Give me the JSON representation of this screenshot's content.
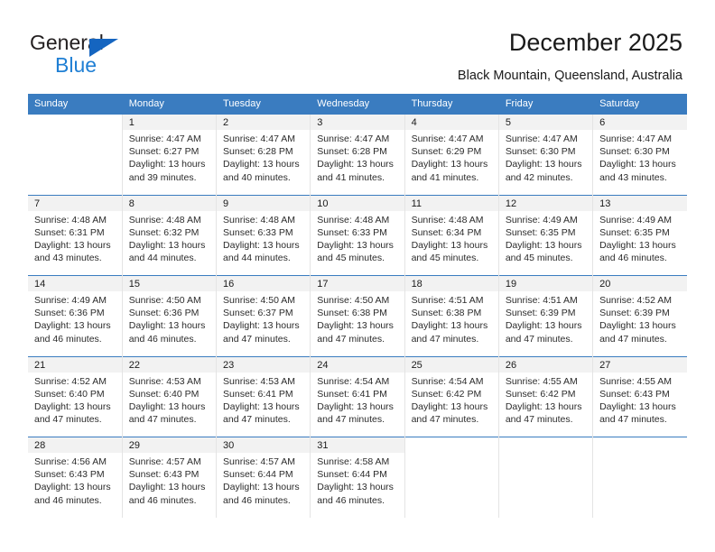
{
  "branding": {
    "name_top": "General",
    "name_bottom": "Blue",
    "triangle_icon": "blue-triangle-icon",
    "accent_color": "#1f7fd4"
  },
  "header": {
    "title": "December 2025",
    "subtitle": "Black Mountain, Queensland, Australia"
  },
  "calendar": {
    "header_bg": "#3a7cc0",
    "header_text_color": "#ffffff",
    "weekday_headers": [
      "Sunday",
      "Monday",
      "Tuesday",
      "Wednesday",
      "Thursday",
      "Friday",
      "Saturday"
    ],
    "weeks": [
      [
        {
          "day": "",
          "lines": []
        },
        {
          "day": "1",
          "lines": [
            "Sunrise: 4:47 AM",
            "Sunset: 6:27 PM",
            "Daylight: 13 hours",
            "and 39 minutes."
          ]
        },
        {
          "day": "2",
          "lines": [
            "Sunrise: 4:47 AM",
            "Sunset: 6:28 PM",
            "Daylight: 13 hours",
            "and 40 minutes."
          ]
        },
        {
          "day": "3",
          "lines": [
            "Sunrise: 4:47 AM",
            "Sunset: 6:28 PM",
            "Daylight: 13 hours",
            "and 41 minutes."
          ]
        },
        {
          "day": "4",
          "lines": [
            "Sunrise: 4:47 AM",
            "Sunset: 6:29 PM",
            "Daylight: 13 hours",
            "and 41 minutes."
          ]
        },
        {
          "day": "5",
          "lines": [
            "Sunrise: 4:47 AM",
            "Sunset: 6:30 PM",
            "Daylight: 13 hours",
            "and 42 minutes."
          ]
        },
        {
          "day": "6",
          "lines": [
            "Sunrise: 4:47 AM",
            "Sunset: 6:30 PM",
            "Daylight: 13 hours",
            "and 43 minutes."
          ]
        }
      ],
      [
        {
          "day": "7",
          "lines": [
            "Sunrise: 4:48 AM",
            "Sunset: 6:31 PM",
            "Daylight: 13 hours",
            "and 43 minutes."
          ]
        },
        {
          "day": "8",
          "lines": [
            "Sunrise: 4:48 AM",
            "Sunset: 6:32 PM",
            "Daylight: 13 hours",
            "and 44 minutes."
          ]
        },
        {
          "day": "9",
          "lines": [
            "Sunrise: 4:48 AM",
            "Sunset: 6:33 PM",
            "Daylight: 13 hours",
            "and 44 minutes."
          ]
        },
        {
          "day": "10",
          "lines": [
            "Sunrise: 4:48 AM",
            "Sunset: 6:33 PM",
            "Daylight: 13 hours",
            "and 45 minutes."
          ]
        },
        {
          "day": "11",
          "lines": [
            "Sunrise: 4:48 AM",
            "Sunset: 6:34 PM",
            "Daylight: 13 hours",
            "and 45 minutes."
          ]
        },
        {
          "day": "12",
          "lines": [
            "Sunrise: 4:49 AM",
            "Sunset: 6:35 PM",
            "Daylight: 13 hours",
            "and 45 minutes."
          ]
        },
        {
          "day": "13",
          "lines": [
            "Sunrise: 4:49 AM",
            "Sunset: 6:35 PM",
            "Daylight: 13 hours",
            "and 46 minutes."
          ]
        }
      ],
      [
        {
          "day": "14",
          "lines": [
            "Sunrise: 4:49 AM",
            "Sunset: 6:36 PM",
            "Daylight: 13 hours",
            "and 46 minutes."
          ]
        },
        {
          "day": "15",
          "lines": [
            "Sunrise: 4:50 AM",
            "Sunset: 6:36 PM",
            "Daylight: 13 hours",
            "and 46 minutes."
          ]
        },
        {
          "day": "16",
          "lines": [
            "Sunrise: 4:50 AM",
            "Sunset: 6:37 PM",
            "Daylight: 13 hours",
            "and 47 minutes."
          ]
        },
        {
          "day": "17",
          "lines": [
            "Sunrise: 4:50 AM",
            "Sunset: 6:38 PM",
            "Daylight: 13 hours",
            "and 47 minutes."
          ]
        },
        {
          "day": "18",
          "lines": [
            "Sunrise: 4:51 AM",
            "Sunset: 6:38 PM",
            "Daylight: 13 hours",
            "and 47 minutes."
          ]
        },
        {
          "day": "19",
          "lines": [
            "Sunrise: 4:51 AM",
            "Sunset: 6:39 PM",
            "Daylight: 13 hours",
            "and 47 minutes."
          ]
        },
        {
          "day": "20",
          "lines": [
            "Sunrise: 4:52 AM",
            "Sunset: 6:39 PM",
            "Daylight: 13 hours",
            "and 47 minutes."
          ]
        }
      ],
      [
        {
          "day": "21",
          "lines": [
            "Sunrise: 4:52 AM",
            "Sunset: 6:40 PM",
            "Daylight: 13 hours",
            "and 47 minutes."
          ]
        },
        {
          "day": "22",
          "lines": [
            "Sunrise: 4:53 AM",
            "Sunset: 6:40 PM",
            "Daylight: 13 hours",
            "and 47 minutes."
          ]
        },
        {
          "day": "23",
          "lines": [
            "Sunrise: 4:53 AM",
            "Sunset: 6:41 PM",
            "Daylight: 13 hours",
            "and 47 minutes."
          ]
        },
        {
          "day": "24",
          "lines": [
            "Sunrise: 4:54 AM",
            "Sunset: 6:41 PM",
            "Daylight: 13 hours",
            "and 47 minutes."
          ]
        },
        {
          "day": "25",
          "lines": [
            "Sunrise: 4:54 AM",
            "Sunset: 6:42 PM",
            "Daylight: 13 hours",
            "and 47 minutes."
          ]
        },
        {
          "day": "26",
          "lines": [
            "Sunrise: 4:55 AM",
            "Sunset: 6:42 PM",
            "Daylight: 13 hours",
            "and 47 minutes."
          ]
        },
        {
          "day": "27",
          "lines": [
            "Sunrise: 4:55 AM",
            "Sunset: 6:43 PM",
            "Daylight: 13 hours",
            "and 47 minutes."
          ]
        }
      ],
      [
        {
          "day": "28",
          "lines": [
            "Sunrise: 4:56 AM",
            "Sunset: 6:43 PM",
            "Daylight: 13 hours",
            "and 46 minutes."
          ]
        },
        {
          "day": "29",
          "lines": [
            "Sunrise: 4:57 AM",
            "Sunset: 6:43 PM",
            "Daylight: 13 hours",
            "and 46 minutes."
          ]
        },
        {
          "day": "30",
          "lines": [
            "Sunrise: 4:57 AM",
            "Sunset: 6:44 PM",
            "Daylight: 13 hours",
            "and 46 minutes."
          ]
        },
        {
          "day": "31",
          "lines": [
            "Sunrise: 4:58 AM",
            "Sunset: 6:44 PM",
            "Daylight: 13 hours",
            "and 46 minutes."
          ]
        },
        {
          "day": "",
          "lines": []
        },
        {
          "day": "",
          "lines": []
        },
        {
          "day": "",
          "lines": []
        }
      ]
    ]
  }
}
